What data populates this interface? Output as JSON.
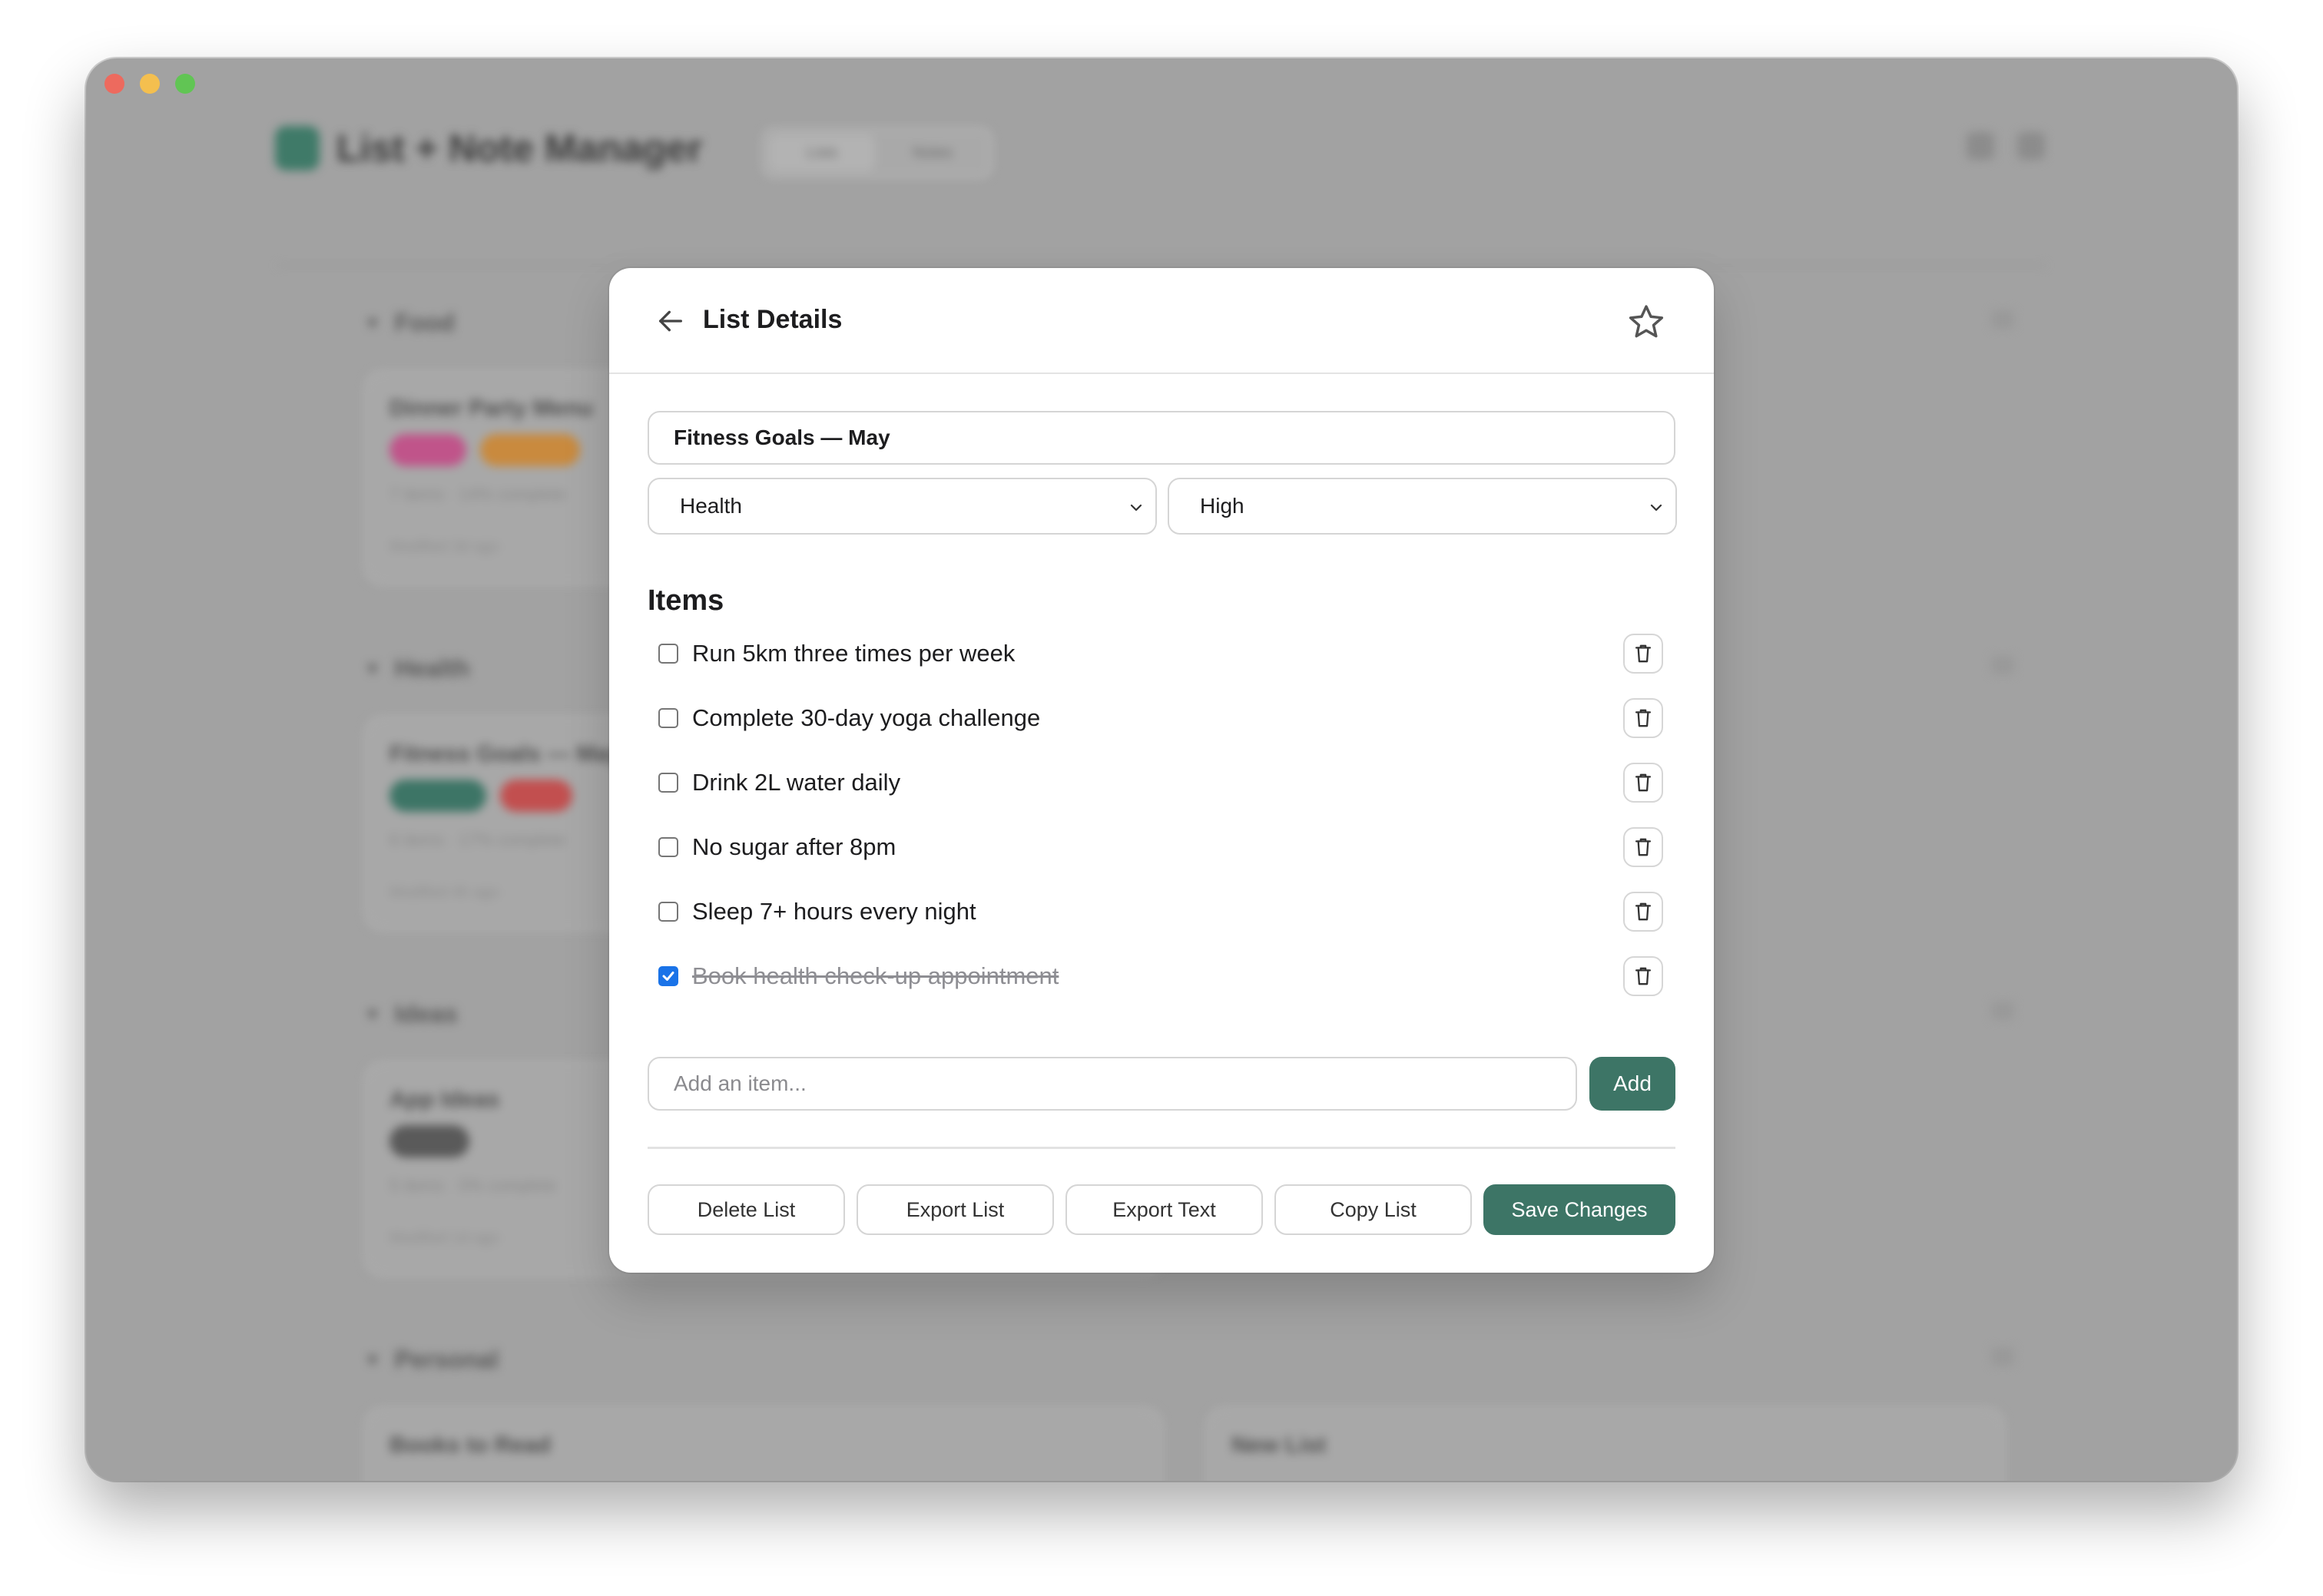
{
  "app": {
    "title": "List + Note Manager",
    "view_tabs": [
      "Lists",
      "Notes"
    ]
  },
  "background": {
    "sections": [
      {
        "name": "Food",
        "card_title": "Dinner Party Menu",
        "meta": "7 items · 14% complete",
        "date": "Modified 3d ago",
        "pill_colors": [
          "#c0548a",
          "#c98a3e"
        ]
      },
      {
        "name": "Health",
        "card_title": "Fitness Goals — May",
        "meta": "6 items · 17% complete",
        "date": "Modified 4h ago",
        "pill_colors": [
          "#3d7566",
          "#c24f4f"
        ]
      },
      {
        "name": "Ideas",
        "card_title": "App Ideas",
        "meta": "5 items · 0% complete",
        "date": "Modified 1d ago",
        "pill_colors": [
          "#5a5a5a"
        ]
      },
      {
        "name": "Personal",
        "card_title": "Books to Read",
        "second_card_title": "New List"
      }
    ]
  },
  "modal": {
    "title": "List Details",
    "back_icon": "arrow-left-icon",
    "star_icon": "star-outline-icon",
    "list_name": "Fitness Goals — May",
    "category": "Health",
    "priority": "High",
    "items_heading": "Items",
    "items": [
      {
        "text": "Run 5km three times per week",
        "checked": false
      },
      {
        "text": "Complete 30-day yoga challenge",
        "checked": false
      },
      {
        "text": "Drink 2L water daily",
        "checked": false
      },
      {
        "text": "No sugar after 8pm",
        "checked": false
      },
      {
        "text": "Sleep 7+ hours every night",
        "checked": false
      },
      {
        "text": "Book health check-up appointment",
        "checked": true
      }
    ],
    "add_placeholder": "Add an item...",
    "add_label": "Add",
    "footer": {
      "delete": "Delete List",
      "export": "Export List",
      "export_text": "Export Text",
      "copy": "Copy List",
      "save": "Save Changes"
    }
  },
  "colors": {
    "accent": "#3d7566",
    "checkbox_checked": "#1a73e8"
  }
}
